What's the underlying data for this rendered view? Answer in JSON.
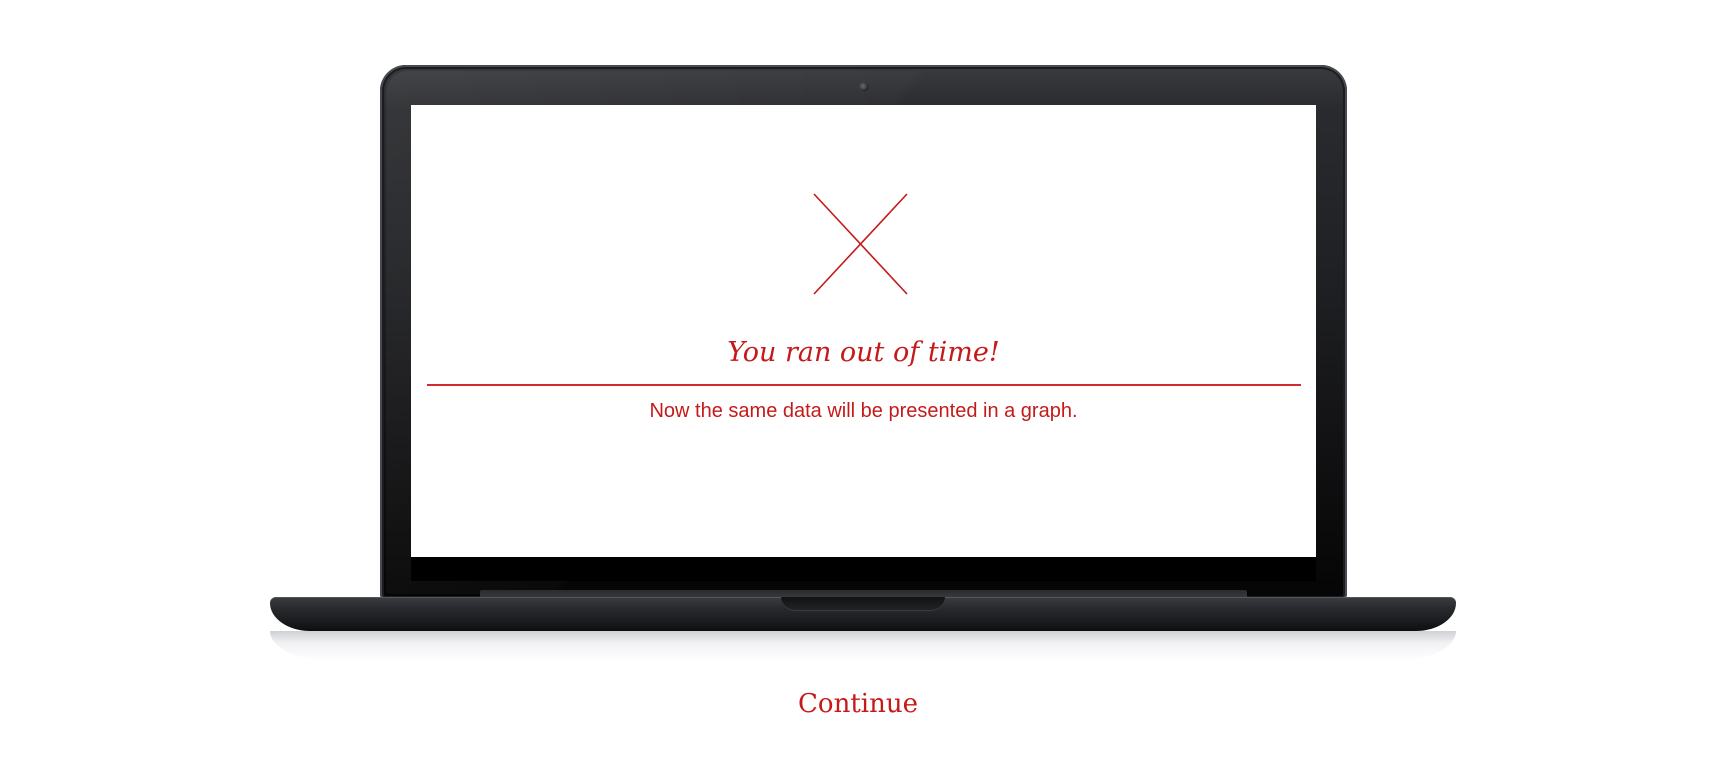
{
  "screen": {
    "headline": "You ran out of time!",
    "message": "Now the same data will be presented in a graph."
  },
  "actions": {
    "continue_label": "Continue"
  },
  "icons": {
    "status": "close-icon"
  },
  "colors": {
    "accent": "#c51a1a",
    "device": "#1f2023"
  }
}
